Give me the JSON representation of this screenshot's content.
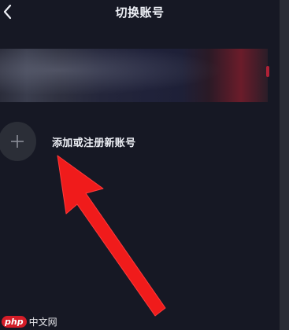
{
  "header": {
    "title": "切换账号"
  },
  "add_account": {
    "label": "添加或注册新账号"
  },
  "watermark": {
    "logo": "php",
    "text": "中文网"
  },
  "icons": {
    "back": "chevron-left-icon",
    "add": "plus-icon",
    "annotation": "red-arrow-icon"
  },
  "colors": {
    "background": "#161824",
    "text": "#eef0f6",
    "add_circle": "#2b2e37",
    "arrow": "#f01b1b",
    "watermark_logo": "#d41d28"
  }
}
